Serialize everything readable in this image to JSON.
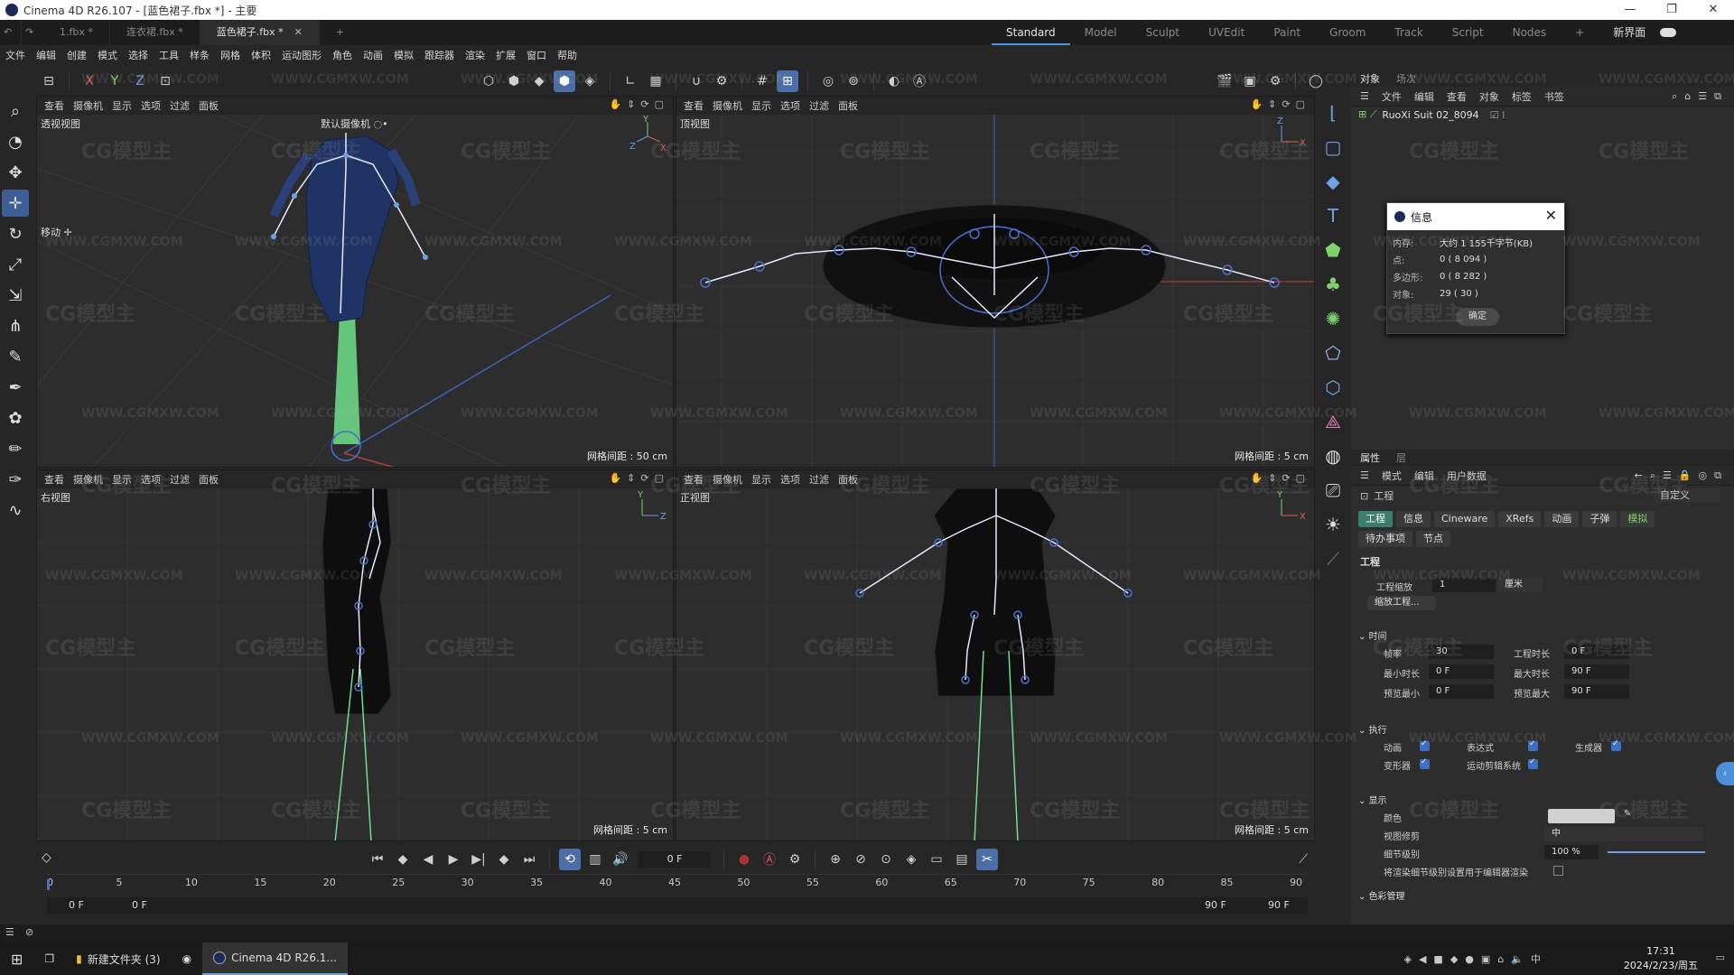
{
  "titlebar": {
    "title": "Cinema 4D R26.107 - [蓝色裙子.fbx *] - 主要",
    "minimize": "—",
    "restore": "❐",
    "close": "✕"
  },
  "file_tabs": [
    {
      "label": "1.fbx *",
      "active": false
    },
    {
      "label": "连衣裙.fbx *",
      "active": false
    },
    {
      "label": "蓝色裙子.fbx *",
      "active": true
    }
  ],
  "new_tab": "+",
  "layouts": [
    "Standard",
    "Model",
    "Sculpt",
    "UVEdit",
    "Paint",
    "Groom",
    "Track",
    "Script",
    "Nodes"
  ],
  "active_layout": "Standard",
  "new_interface": "新界面",
  "menu": [
    "文件",
    "编辑",
    "创建",
    "模式",
    "选择",
    "工具",
    "样条",
    "网格",
    "体积",
    "运动图形",
    "角色",
    "动画",
    "模拟",
    "跟踪器",
    "渲染",
    "扩展",
    "窗口",
    "帮助"
  ],
  "axis_lock": {
    "x": "X",
    "y": "Y",
    "z": "Z"
  },
  "viewport_menu": [
    "查看",
    "摄像机",
    "显示",
    "选项",
    "过滤",
    "面板"
  ],
  "viewports": {
    "perspective": {
      "name": "透视视图",
      "camera": "默认摄像机 ◌•",
      "grid": "网格间距 : 50 cm",
      "move_label": "移动 ✛"
    },
    "top": {
      "name": "顶视图",
      "grid": "网格间距 : 5 cm"
    },
    "right": {
      "name": "右视图",
      "grid": "网格间距 : 5 cm"
    },
    "front": {
      "name": "正视图",
      "grid": "网格间距 : 5 cm"
    }
  },
  "object_panel": {
    "tabs": [
      "对象",
      "场次"
    ],
    "menu": [
      "文件",
      "编辑",
      "查看",
      "对象",
      "标签",
      "书签"
    ],
    "object_name": "RuoXi Suit 02_8094"
  },
  "info_dialog": {
    "title": "信息",
    "rows": [
      {
        "key": "内存:",
        "value": "大约 1 155千字节(KB)"
      },
      {
        "key": "点:",
        "value": "0 ( 8 094 )"
      },
      {
        "key": "多边形:",
        "value": "0 ( 8 282 )"
      },
      {
        "key": "对象:",
        "value": "29 ( 30 )"
      }
    ],
    "ok": "确定"
  },
  "attr_panel": {
    "tabs": [
      "属性",
      "层"
    ],
    "menu": [
      "模式",
      "编辑",
      "用户数据"
    ],
    "title": "工程",
    "preset": "自定义",
    "subtabs": [
      "工程",
      "信息",
      "Cineware",
      "XRefs",
      "动画",
      "子弹",
      "模拟"
    ],
    "subtabs2": [
      "待办事项",
      "节点"
    ],
    "section_title": "工程",
    "scale_label": "工程缩放",
    "scale_value": "1",
    "scale_unit": "厘米",
    "scale_button": "缩放工程...",
    "time_section": "时间",
    "fps_label": "帧率",
    "fps": "30",
    "duration_label": "工程时长",
    "duration": "0 F",
    "min_label": "最小时长",
    "min": "0 F",
    "max_label": "最大时长",
    "max": "90 F",
    "pmin_label": "预览最小",
    "pmin": "0 F",
    "pmax_label": "预览最大",
    "pmax": "90 F",
    "exec_section": "执行",
    "exec": [
      "动画",
      "表达式",
      "生成器",
      "变形器",
      "运动剪辑系统"
    ],
    "display_section": "显示",
    "color_label": "颜色",
    "vp_label": "视图修剪",
    "vp_value": "中",
    "lod_label": "细节级别",
    "lod_value": "100 %",
    "lod_check": "将渲染细节级别设置用于编辑器渲染",
    "color_section": "色彩管理"
  },
  "timeline": {
    "frame": "0 F",
    "ticks": [
      "0",
      "5",
      "10",
      "15",
      "20",
      "25",
      "30",
      "35",
      "40",
      "45",
      "50",
      "55",
      "60",
      "65",
      "70",
      "75",
      "80",
      "85",
      "90"
    ],
    "start": "0 F",
    "start2": "0 F",
    "end": "90 F",
    "end2": "90 F"
  },
  "taskbar": {
    "folder": "新建文件夹 (3)",
    "app": "Cinema 4D R26.1...",
    "time": "17:31",
    "date": "2024/2/23/周五",
    "ime": "中"
  },
  "watermark": "CG模型主",
  "watermark_url": "WWW.CGMXW.COM"
}
